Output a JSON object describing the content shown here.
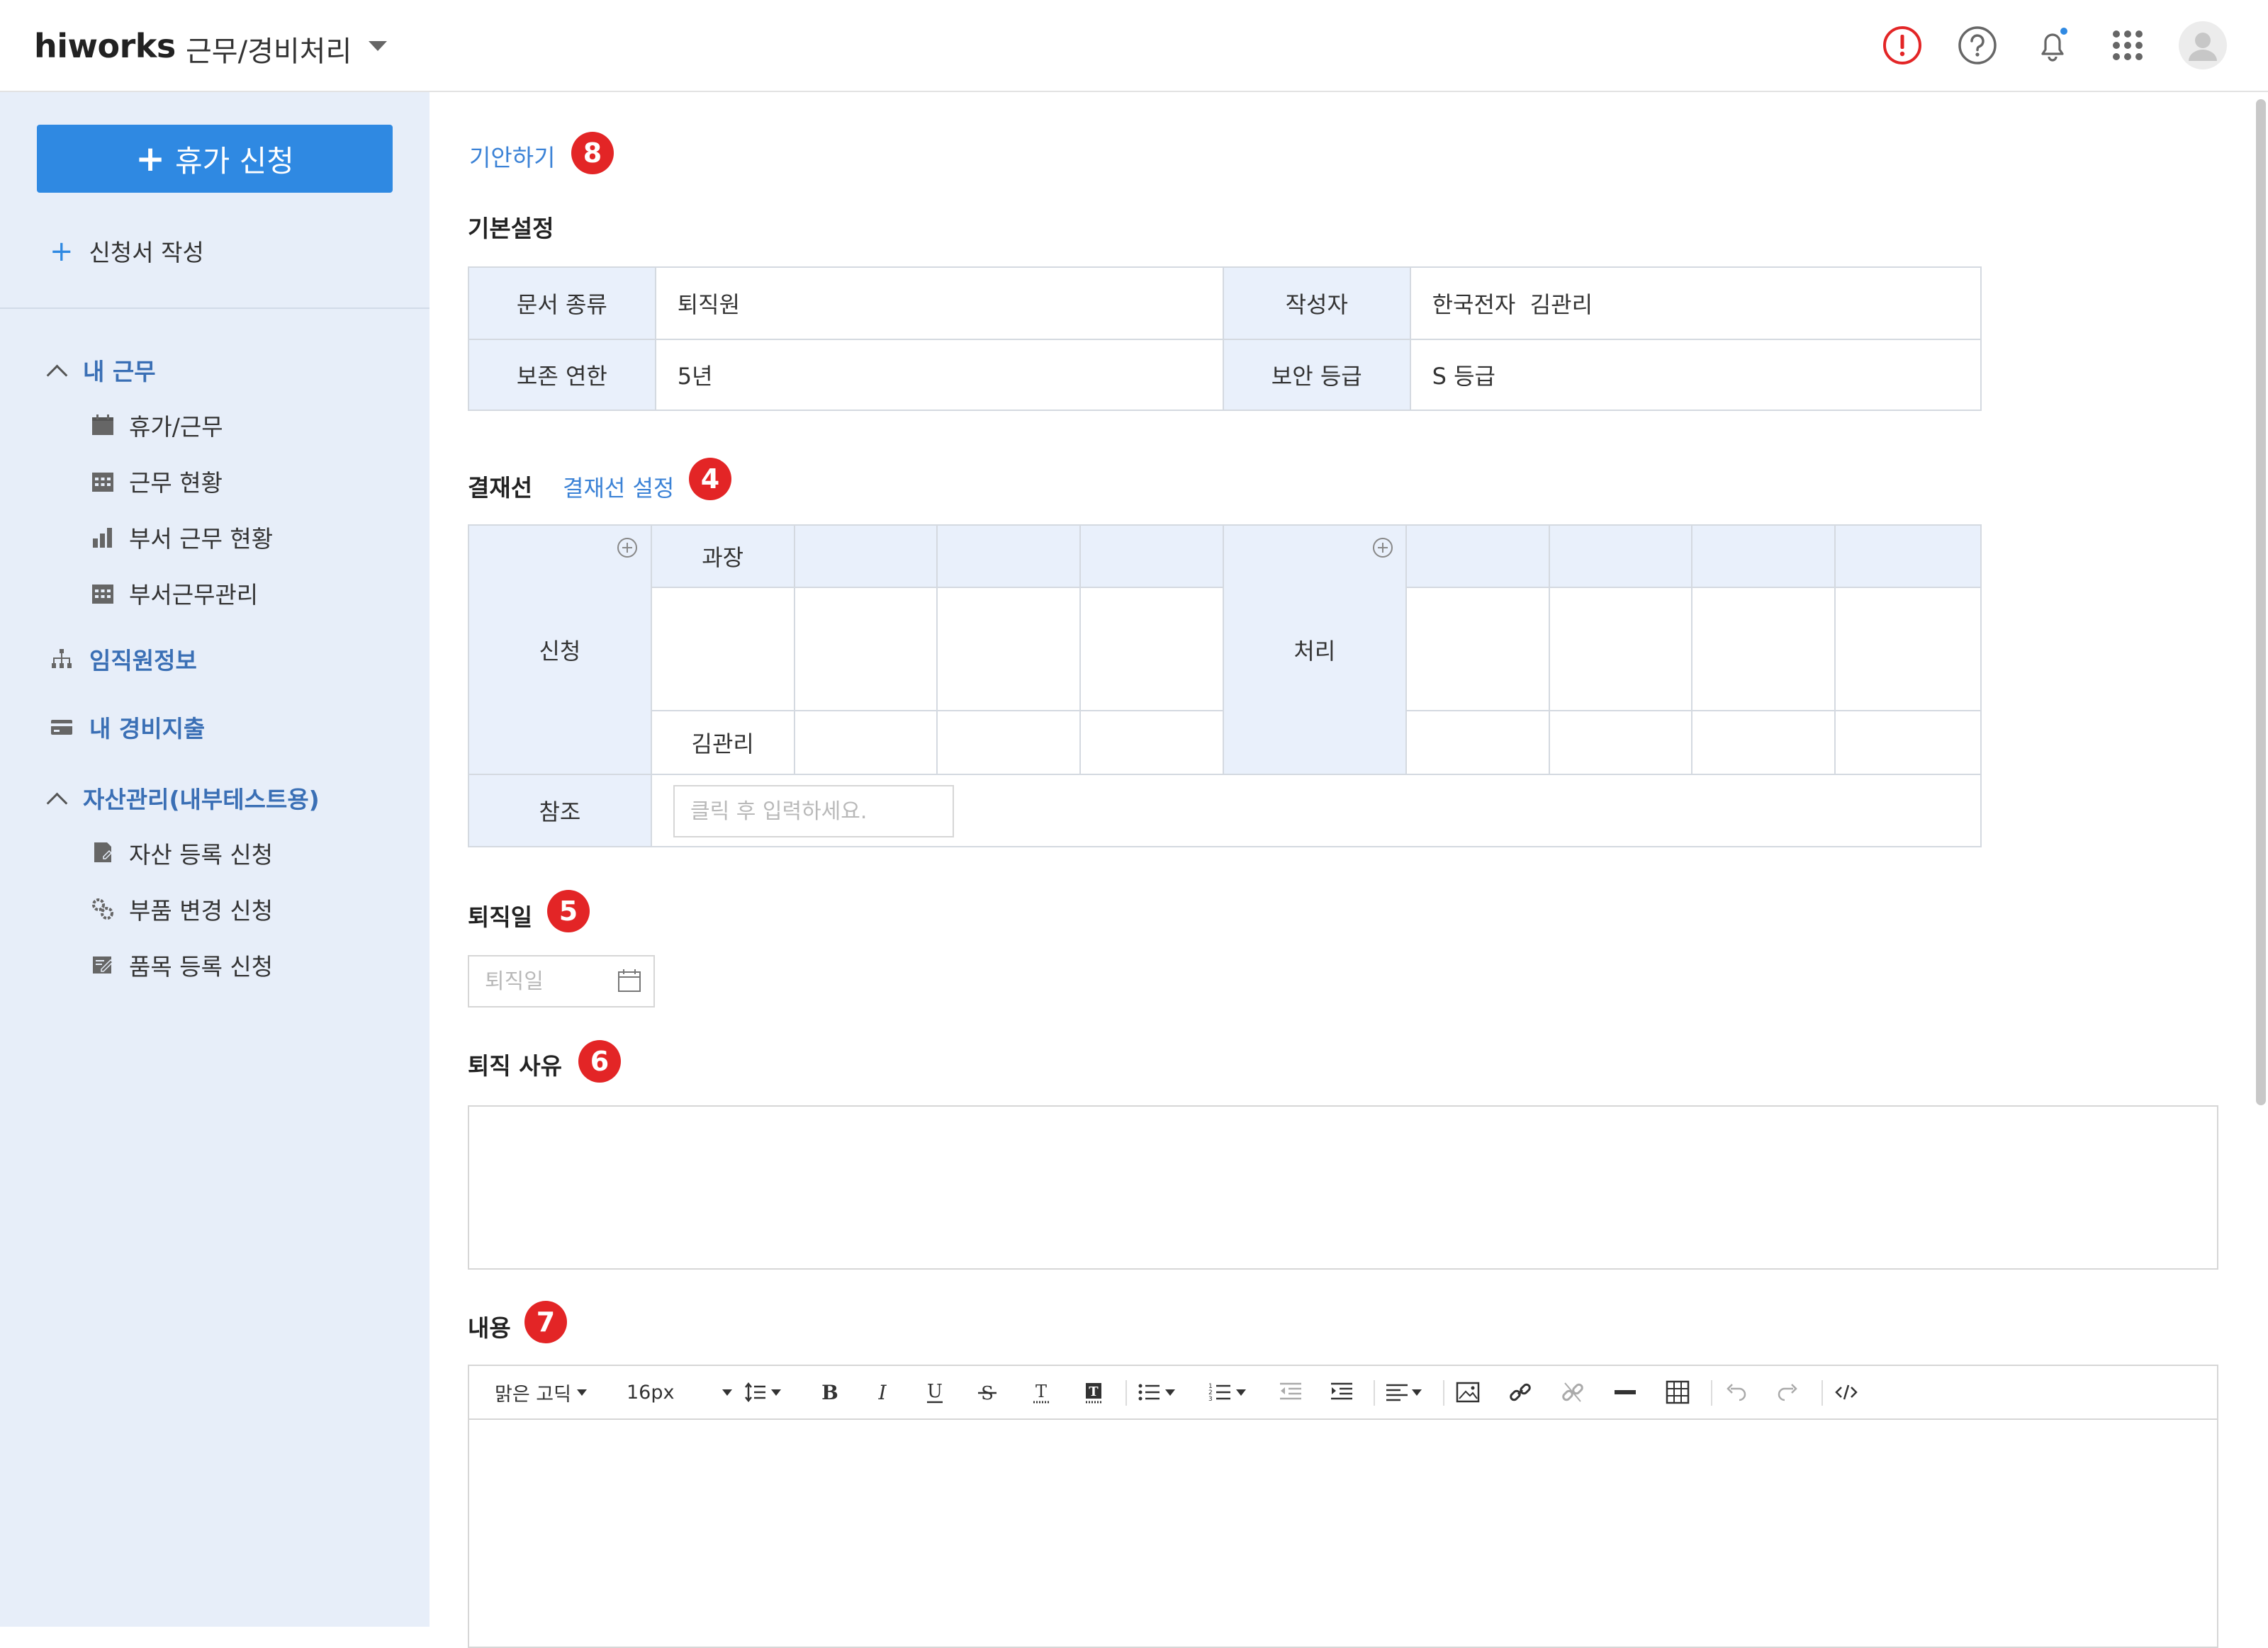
{
  "header": {
    "brand": "hiworks",
    "menu_title": "근무/경비처리",
    "icons": [
      "alert-icon",
      "help-icon",
      "bell-icon",
      "apps-icon",
      "avatar"
    ]
  },
  "sidebar": {
    "leave_button": "휴가 신청",
    "write_link": "신청서 작성",
    "section_work": "내 근무",
    "work_items": [
      "휴가/근무",
      "근무 현황",
      "부서 근무 현황",
      "부서근무관리"
    ],
    "employee_info": "임직원정보",
    "my_expense": "내 경비지출",
    "section_asset": "자산관리(내부테스트용)",
    "asset_items": [
      "자산 등록 신청",
      "부품 변경 신청",
      "품목 등록 신청"
    ]
  },
  "main": {
    "draft_link": "기안하기",
    "badges": {
      "draft": "8",
      "approval": "4",
      "retire_date": "5",
      "reason": "6",
      "content": "7"
    },
    "basic_settings": {
      "title": "기본설정",
      "rows": [
        {
          "label1": "문서 종류",
          "value1": "퇴직원",
          "label2": "작성자",
          "value2": "한국전자  김관리"
        },
        {
          "label1": "보존 연한",
          "value1": "5년",
          "label2": "보안 등급",
          "value2": "S 등급"
        }
      ]
    },
    "approval": {
      "title": "결재선",
      "setting_link": "결재선 설정",
      "apply_label": "신청",
      "process_label": "처리",
      "position": "과장",
      "approver": "김관리",
      "reference_label": "참조",
      "reference_placeholder": "클릭 후 입력하세요."
    },
    "retire_date": {
      "title": "퇴직일",
      "placeholder": "퇴직일"
    },
    "retire_reason": {
      "title": "퇴직 사유"
    },
    "content": {
      "title": "내용",
      "font_family": "맑은 고딕",
      "font_size": "16px"
    }
  },
  "colors": {
    "primary": "#2f89e2",
    "sidebar_bg": "#e7eef9",
    "link": "#3b82d6",
    "badge": "#e32526",
    "table_header": "#e9f0fb"
  }
}
